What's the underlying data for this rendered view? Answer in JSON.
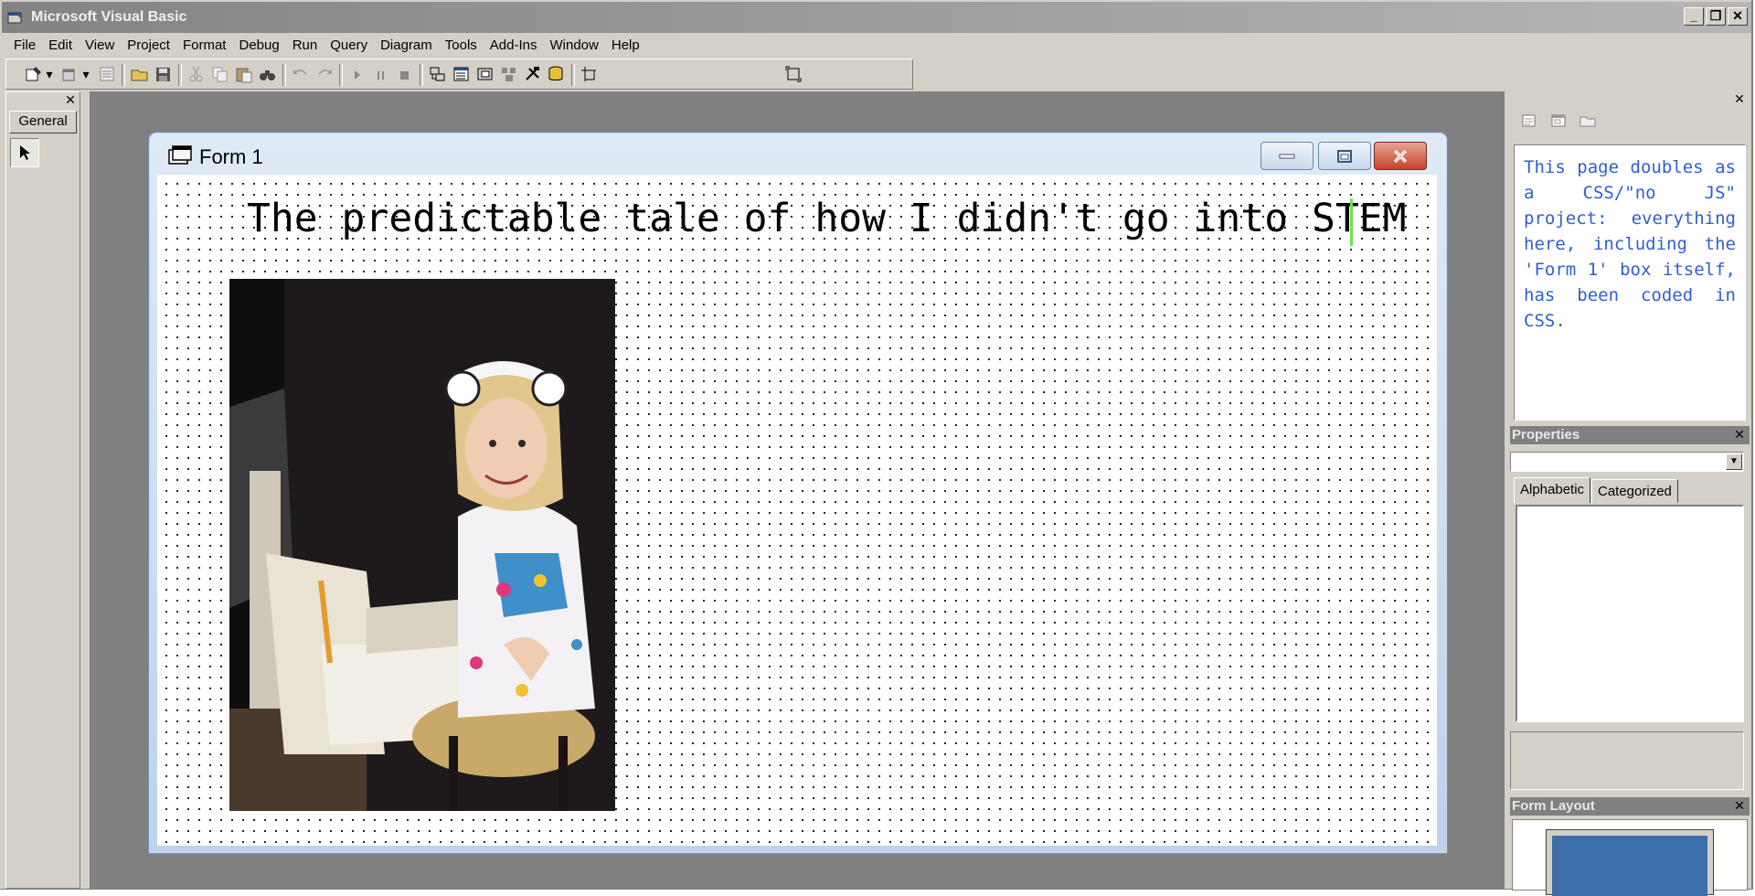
{
  "window": {
    "title": "Microsoft Visual Basic",
    "minimize": "_",
    "restore": "❐",
    "close": "✕"
  },
  "menu": [
    "File",
    "Edit",
    "View",
    "Project",
    "Format",
    "Debug",
    "Run",
    "Query",
    "Diagram",
    "Tools",
    "Add-Ins",
    "Window",
    "Help"
  ],
  "toolbox": {
    "close": "✕",
    "tab_label": "General",
    "tools": [
      "pointer-icon"
    ]
  },
  "form": {
    "title": "Form 1",
    "heading": "The predictable tale of how I didn't go into STEM"
  },
  "project_panel": {
    "close": "✕",
    "note": "This page doubles as a CSS/\"no JS\" project: everything here, including the 'Form 1' box itself, has been coded in CSS."
  },
  "properties": {
    "title": "Properties",
    "close": "✕",
    "combo_value": "",
    "tabs": [
      "Alphabetic",
      "Categorized"
    ],
    "active_tab": "Alphabetic"
  },
  "form_layout": {
    "title": "Form Layout",
    "close": "✕"
  },
  "colors": {
    "chrome": "#d4d0c8",
    "workspace": "#808080",
    "note_text": "#2f5fd0",
    "cursor": "#6ce34c",
    "layout_form": "#3c6ea9"
  }
}
